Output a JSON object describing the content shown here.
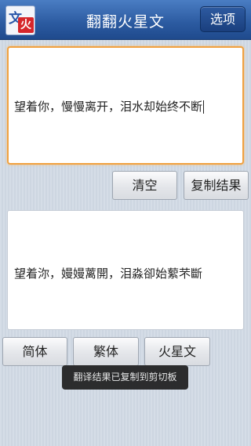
{
  "titlebar": {
    "icon_glyph_top": "文",
    "icon_glyph_bottom": "火",
    "title": "翻翻火星文",
    "options_label": "选项"
  },
  "input": {
    "value": "望着你，慢慢离开，泪水却始终不断"
  },
  "actions": {
    "clear_label": "清空",
    "copy_label": "复制结果"
  },
  "output": {
    "value": "望着沵，嫚嫚蓠開，泪淼卻始蕠芣斷"
  },
  "modes": {
    "simplified_label": "简体",
    "traditional_label": "繁体",
    "martian_label": "火星文"
  },
  "toast": {
    "message": "翻译结果已复制到剪切板"
  },
  "colors": {
    "titlebar": "#2b5aa0",
    "input_focus_border": "#f0a140"
  }
}
